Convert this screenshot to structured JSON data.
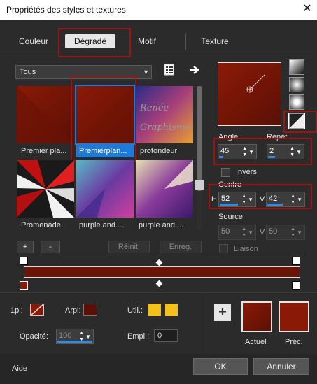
{
  "window": {
    "title": "Propriétés des styles et textures",
    "close_glyph": "✕"
  },
  "tabs": [
    {
      "label": "Couleur"
    },
    {
      "label": "Dégradé"
    },
    {
      "label": "Motif"
    },
    {
      "label": "Texture"
    }
  ],
  "filter": {
    "value": "Tous"
  },
  "gradients": [
    {
      "label": "Premier pla..."
    },
    {
      "label": "Premierplan..."
    },
    {
      "label": "profondeur"
    },
    {
      "label": "Promenade..."
    },
    {
      "label": "purple and ..."
    },
    {
      "label": "purple and ..."
    }
  ],
  "watermark": {
    "line1": "Renée",
    "line2": "Graphisme"
  },
  "list_buttons": {
    "add": "+",
    "remove": "-",
    "reset": "Réinit.",
    "save": "Enreg."
  },
  "angle": {
    "label": "Angle",
    "value": "45"
  },
  "repeat": {
    "label": "Répét.",
    "value": "2"
  },
  "invert": {
    "label": "Invers"
  },
  "centre": {
    "label": "Centre",
    "h_label": "H",
    "h_value": "52",
    "v_label": "V",
    "v_value": "42"
  },
  "source": {
    "label": "Source",
    "h_value": "50",
    "v_value": "50",
    "link_label": "Liaison"
  },
  "bottom": {
    "fg_label": "1pl:",
    "bg_label": "Arpl:",
    "util_label": "Util.:",
    "opacity_label": "Opacité:",
    "opacity_value": "100",
    "empl_label": "Empl.:",
    "empl_value": "0",
    "current_label": "Actuel",
    "previous_label": "Préc.",
    "add_swatch": "+"
  },
  "footer": {
    "help": "Aide",
    "ok": "OK",
    "cancel": "Annuler"
  },
  "colors": {
    "dark_red": "#6b1408",
    "red": "#8a1a06",
    "accent_blue": "#1e7ad8",
    "highlight_red": "#9a1414",
    "util_yellow": "#f2c11e"
  }
}
